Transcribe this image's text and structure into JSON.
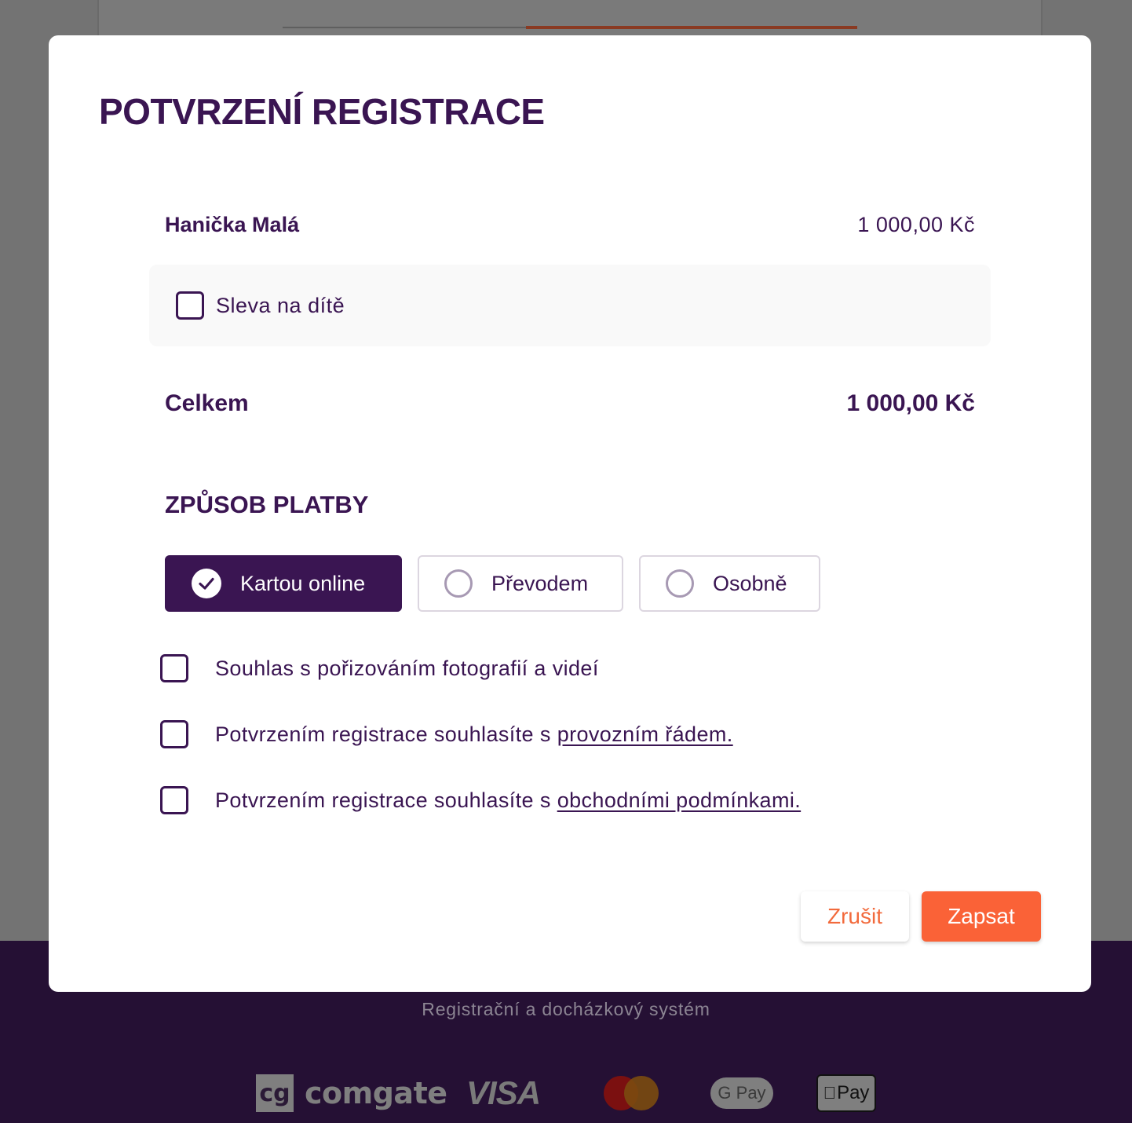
{
  "footer": {
    "subtitle": "Registrační a docházkový systém",
    "logos": {
      "comgate_mark": "cg",
      "comgate_name": "comgate",
      "visa": "VISA",
      "gpay": "G Pay",
      "applepay": "Pay"
    }
  },
  "modal": {
    "title": "POTVRZENÍ REGISTRACE",
    "person": {
      "name": "Hanička Malá",
      "price": "1 000,00 Kč"
    },
    "discount": {
      "label": "Sleva na dítě",
      "checked": false
    },
    "total": {
      "label": "Celkem",
      "value": "1 000,00 Kč"
    },
    "payment": {
      "title": "ZPŮSOB PLATBY",
      "options": [
        {
          "label": "Kartou online",
          "selected": true
        },
        {
          "label": "Převodem",
          "selected": false
        },
        {
          "label": "Osobně",
          "selected": false
        }
      ]
    },
    "consents": [
      {
        "text": "Souhlas s pořizováním fotografií a videí",
        "link": ""
      },
      {
        "text": "Potvrzením registrace souhlasíte s ",
        "link": "provozním řádem."
      },
      {
        "text": "Potvrzením registrace souhlasíte s ",
        "link": "obchodními podmínkami."
      }
    ],
    "buttons": {
      "cancel": "Zrušit",
      "submit": "Zapsat"
    }
  },
  "colors": {
    "primary": "#3a1552",
    "accent": "#fa6237",
    "overlay": "#737373",
    "footer_bg": "#251034"
  }
}
